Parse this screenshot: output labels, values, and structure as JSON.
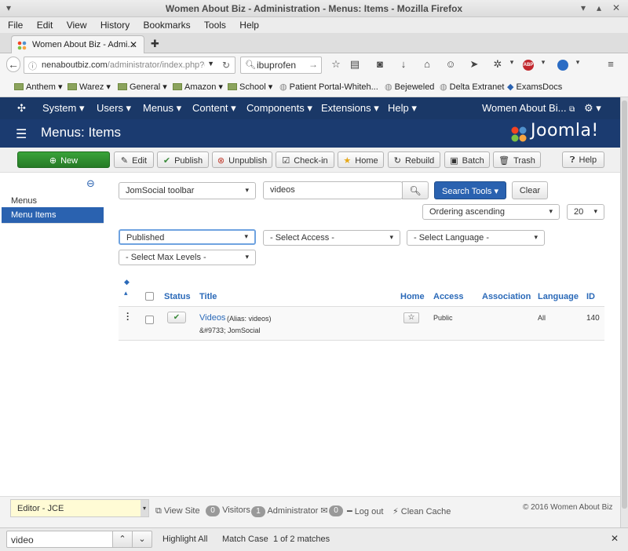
{
  "window": {
    "title": "Women About Biz - Administration - Menus: Items - Mozilla Firefox"
  },
  "menubar": [
    "File",
    "Edit",
    "View",
    "History",
    "Bookmarks",
    "Tools",
    "Help"
  ],
  "tab": {
    "label": "Women About Biz - Admi..."
  },
  "nav": {
    "url_host": "nenaboutbiz.com",
    "url_path": "/administrator/index.php?o",
    "search": "ibuprofen"
  },
  "bookmarks": [
    {
      "label": "Anthem",
      "type": "folder"
    },
    {
      "label": "Warez",
      "type": "folder"
    },
    {
      "label": "General",
      "type": "folder"
    },
    {
      "label": "Amazon",
      "type": "folder"
    },
    {
      "label": "School",
      "type": "folder"
    },
    {
      "label": "Patient Portal-Whiteh...",
      "type": "link"
    },
    {
      "label": "Bejeweled",
      "type": "link"
    },
    {
      "label": "Delta Extranet",
      "type": "link"
    },
    {
      "label": "ExamsDocs",
      "type": "link"
    }
  ],
  "joomla": {
    "menu": [
      "System ▾",
      "Users ▾",
      "Menus ▾",
      "Content ▾",
      "Components ▾",
      "Extensions ▾",
      "Help ▾"
    ],
    "site_name": "Women About Bi...",
    "page_title": "Menus: Items",
    "logo": "Joomla!",
    "toolbar": {
      "new": "New",
      "edit": "Edit",
      "publish": "Publish",
      "unpublish": "Unpublish",
      "checkin": "Check-in",
      "home": "Home",
      "rebuild": "Rebuild",
      "batch": "Batch",
      "trash": "Trash",
      "help": "Help"
    },
    "sidebar": {
      "menus": "Menus",
      "menu_items": "Menu Items"
    },
    "filters": {
      "menu": "JomSocial toolbar",
      "search_value": "videos",
      "search_tools": "Search Tools",
      "clear": "Clear",
      "ordering": "Ordering ascending",
      "limit": "20",
      "status": "Published",
      "access": "- Select Access -",
      "language": "- Select Language -",
      "max_levels": "- Select Max Levels -"
    },
    "table": {
      "headers": {
        "status": "Status",
        "title": "Title",
        "home": "Home",
        "access": "Access",
        "association": "Association",
        "language": "Language",
        "id": "ID"
      },
      "rows": [
        {
          "title": "Videos",
          "alias": "(Alias: videos)",
          "sub": "&#9733; JomSocial",
          "access": "Public",
          "language": "All",
          "id": "140"
        }
      ]
    },
    "status": {
      "editor": "Editor - JCE",
      "view_site": "View Site",
      "visitors_count": "0",
      "visitors": "Visitors",
      "admin_count": "1",
      "admin": "Administrator",
      "msg_count": "0",
      "logout": "Log out",
      "clean_cache": "Clean Cache",
      "copyright": "© 2016 Women About Biz"
    }
  },
  "findbar": {
    "query": "video",
    "highlight": "Highlight All",
    "match_case": "Match Case",
    "matches": "1 of 2 matches"
  },
  "colors": {
    "joomla_header": "#1a3867",
    "new_button": "#2f8f2f",
    "search_tools": "#2a62b0",
    "active_sidebar": "#2a62b0"
  }
}
